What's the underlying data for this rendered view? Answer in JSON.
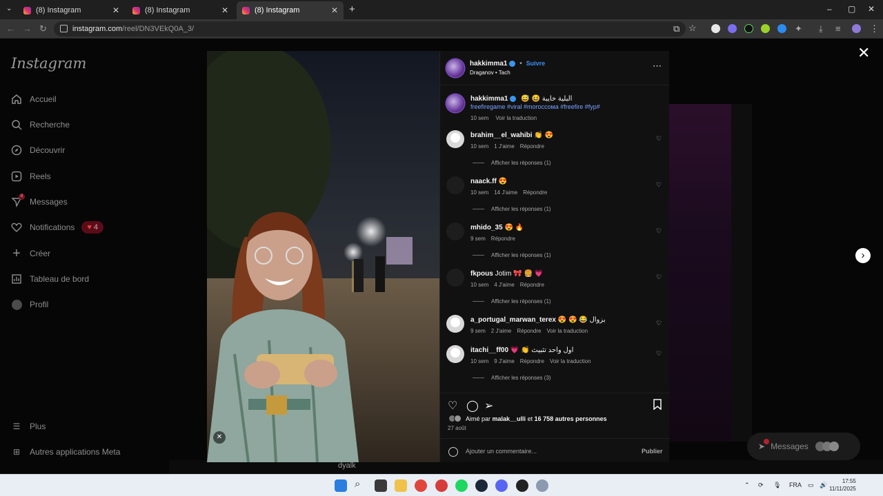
{
  "browser": {
    "tabs": [
      {
        "title": "(8) Instagram"
      },
      {
        "title": "(8) Instagram"
      },
      {
        "title": "(8) Instagram"
      }
    ],
    "url_domain": "instagram.com",
    "url_path": "/reel/DN3VEkQ0A_3/"
  },
  "sidebar": {
    "logo": "Instagram",
    "items": [
      {
        "label": "Accueil",
        "icon": "home-icon"
      },
      {
        "label": "Recherche",
        "icon": "search-icon"
      },
      {
        "label": "Découvrir",
        "icon": "compass-icon"
      },
      {
        "label": "Reels",
        "icon": "reels-icon"
      },
      {
        "label": "Messages",
        "icon": "messenger-icon"
      },
      {
        "label": "Notifications",
        "icon": "heart-icon"
      },
      {
        "label": "Créer",
        "icon": "plus-icon"
      },
      {
        "label": "Tableau de bord",
        "icon": "dashboard-icon"
      },
      {
        "label": "Profil",
        "icon": "profile-avatar"
      }
    ],
    "notif_count": "4",
    "messages_badge": "8",
    "more": "Plus",
    "meta": "Autres applications Meta"
  },
  "post": {
    "username": "hakkimma1",
    "follow": "Suivre",
    "audio": "Draganov • Tach",
    "caption_text": "😅 😆 البلية خايبة",
    "hashtags": "freefiregame #viral #moroccoмa #freefire #fyp#",
    "caption_time": "10 sem",
    "translate": "Voir la traduction"
  },
  "comments": [
    {
      "user": "brahim__el_wahibi",
      "text": "👏 😍",
      "time": "10 sem",
      "likes": "1 J'aime",
      "reply": "Répondre",
      "translate": "",
      "replies": "Afficher les réponses (1)",
      "avatar": "ghost"
    },
    {
      "user": "naack.ff",
      "text": "😍",
      "time": "10 sem",
      "likes": "14 J'aime",
      "reply": "Répondre",
      "translate": "",
      "replies": "Afficher les réponses (1)",
      "avatar": "plain"
    },
    {
      "user": "mhido_35",
      "text": "😍 🔥",
      "time": "9 sem",
      "likes": "",
      "reply": "Répondre",
      "translate": "",
      "replies": "Afficher les réponses (1)",
      "avatar": "plain"
    },
    {
      "user": "fkpous",
      "text": "Jotim 🎀 🍔 💗",
      "time": "10 sem",
      "likes": "4 J'aime",
      "reply": "Répondre",
      "translate": "",
      "replies": "Afficher les réponses (1)",
      "avatar": "plain"
    },
    {
      "user": "a_portugal_marwan_terex",
      "text": "😍 😍 😂 بزوال",
      "time": "9 sem",
      "likes": "2 J'aime",
      "reply": "Répondre",
      "translate": "Voir la traduction",
      "replies": "",
      "avatar": "ghost"
    },
    {
      "user": "itachi__ff00",
      "text": "💗 👏 اول واحد تثبيث",
      "time": "10 sem",
      "likes": "9 J'aime",
      "reply": "Répondre",
      "translate": "Voir la traduction",
      "replies": "Afficher les réponses (3)",
      "avatar": "ghost"
    }
  ],
  "likes": {
    "prefix": "Aimé par",
    "user": "malak__ulli",
    "mid": "et",
    "others": "16 758 autres personnes"
  },
  "post_date": "27 août",
  "comment_box": {
    "placeholder": "Ajouter un commentaire...",
    "publish": "Publier"
  },
  "floating_messages": "Messages",
  "bottom_strip_text": "dyalk",
  "taskbar": {
    "lang": "FRA",
    "time": "17:55",
    "date": "11/11/2025"
  }
}
